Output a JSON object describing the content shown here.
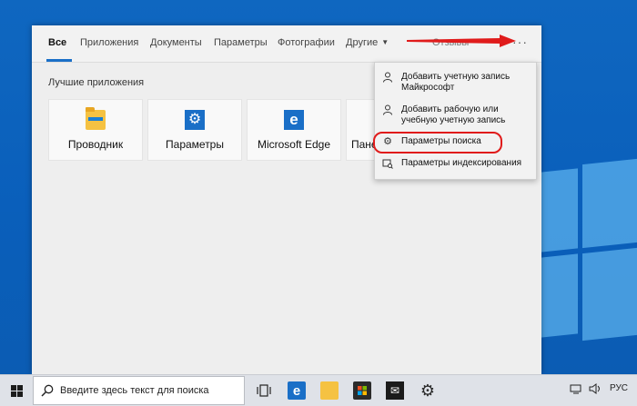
{
  "search_panel": {
    "tabs": [
      {
        "label": "Все"
      },
      {
        "label": "Приложения"
      },
      {
        "label": "Документы"
      },
      {
        "label": "Параметры"
      },
      {
        "label": "Фотографии"
      },
      {
        "label": "Другие"
      }
    ],
    "feedback_label": "Отзывы",
    "more_label": "···",
    "best_apps_title": "Лучшие приложения",
    "tiles": [
      {
        "label": "Проводник",
        "icon": "file-explorer-icon"
      },
      {
        "label": "Параметры",
        "icon": "settings-gear-icon"
      },
      {
        "label": "Microsoft Edge",
        "icon": "edge-icon"
      },
      {
        "label": "Панель управления",
        "icon": "control-panel-icon"
      }
    ]
  },
  "more_menu": {
    "items": [
      {
        "label": "Добавить учетную запись Майкрософт",
        "icon": "person-icon"
      },
      {
        "label": "Добавить рабочую или учебную учетную запись",
        "icon": "person-icon"
      },
      {
        "label": "Параметры поиска",
        "icon": "gear-icon"
      },
      {
        "label": "Параметры индексирования",
        "icon": "indexing-icon"
      }
    ],
    "highlight_color": "#e01b1b"
  },
  "taskbar": {
    "search_placeholder": "Введите здесь текст для поиска",
    "language": "РУС",
    "pinned": [
      "task-view-icon",
      "edge-icon",
      "file-explorer-icon",
      "store-icon",
      "mail-icon",
      "settings-icon"
    ]
  },
  "colors": {
    "accent": "#1a6fc7",
    "arrow": "#e01b1b",
    "desktop": "#0f67c0"
  }
}
